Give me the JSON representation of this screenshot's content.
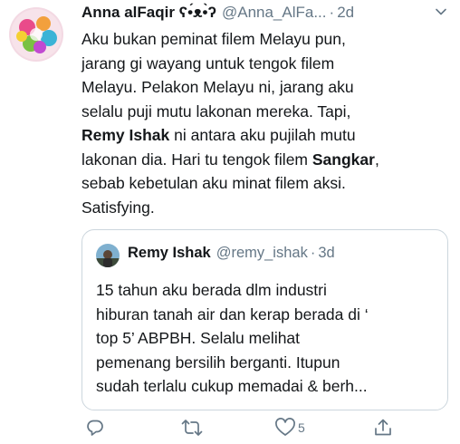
{
  "tweet": {
    "author_name": "Anna alFaqir ʕ•́ᴥ•̀ʔ",
    "author_handle": "@Anna_AlFa...",
    "separator": "·",
    "time": "2d",
    "body_lines": [
      [
        "Aku bukan peminat filem Melayu pun,"
      ],
      [
        "jarang gi wayang untuk tengok filem"
      ],
      [
        "Melayu. Pelakon Melayu ni, jarang aku"
      ],
      [
        "selalu puji mutu lakonan mereka. Tapi,"
      ],
      [
        "",
        "Remy Ishak",
        " ni antara aku pujilah mutu"
      ],
      [
        "lakonan dia. Hari tu tengok filem ",
        "Sangkar",
        ","
      ],
      [
        "sebab kebetulan aku minat filem aksi."
      ],
      [
        "Satisfying."
      ]
    ],
    "body": {
      "l1": "Aku bukan peminat filem Melayu pun,",
      "l2": "jarang gi wayang untuk tengok filem",
      "l3": "Melayu. Pelakon Melayu ni, jarang aku",
      "l4": "selalu puji mutu lakonan mereka. Tapi,",
      "l5_bold": "Remy Ishak",
      "l5_rest": " ni antara aku pujilah mutu",
      "l6_pre": "lakonan dia. Hari tu tengok filem ",
      "l6_bold": "Sangkar",
      "l6_post": ",",
      "l7": "sebab kebetulan aku minat filem aksi.",
      "l8": "Satisfying."
    }
  },
  "quoted_tweet": {
    "author_name": "Remy Ishak",
    "author_handle": "@remy_ishak",
    "separator": "·",
    "time": "3d",
    "text": {
      "l1": "15 tahun aku berada dlm industri",
      "l2": "hiburan tanah air dan kerap berada di ‘",
      "l3": "top 5’ ABPBH. Selalu melihat",
      "l4": "pemenang bersilih berganti. Itupun",
      "l5": "sudah terlalu cukup memadai & berh..."
    }
  },
  "actions": {
    "reply_icon": "reply-icon",
    "retweet_icon": "retweet-icon",
    "like_icon": "heart-icon",
    "like_count": "5",
    "share_icon": "share-icon"
  },
  "colors": {
    "text": "#14171a",
    "secondary": "#657786",
    "border": "#ccd6dd"
  }
}
